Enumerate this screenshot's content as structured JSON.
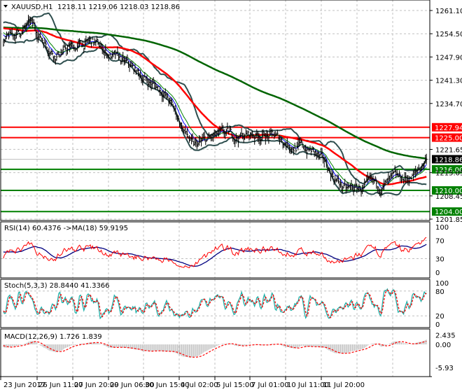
{
  "header": {
    "symbol": "XAUUSD,H1",
    "ohlc": "1218.11 1219.06 1218.03 1218.86"
  },
  "colors": {
    "background": "#ffffff",
    "grid": "#c0c0c0",
    "bars": "#000000",
    "ma_fast": "#0000ff",
    "ma_mid": "#008000",
    "ma_red": "#ff0000",
    "ma_long": "#006400",
    "bollinger": "#2f4f4f",
    "resistance": "#ff0000",
    "support": "#008000",
    "rsi": "#ff0000",
    "rsi_ma": "#000080",
    "stoch_main": "#20b2aa",
    "stoch_signal": "#ff0000",
    "macd_hist": "#c0c0c0",
    "macd_signal": "#ff0000"
  },
  "chart_data": [
    {
      "type": "candlestick-bars",
      "title": "XAUUSD,H1",
      "ylim": [
        1201.85,
        1263.5
      ],
      "y_ticks": [
        "1261.10",
        "1254.50",
        "1247.90",
        "1241.30",
        "1234.70",
        "1221.65",
        "1215.05",
        "1208.45",
        "1201.85"
      ],
      "x_ticks": [
        "23 Jun 2017",
        "26 Jun 11:00",
        "27 Jun 20:00",
        "29 Jun 06:00",
        "30 Jun 15:00",
        "4 Jul 02:00",
        "5 Jul 15:00",
        "7 Jul 01:00",
        "10 Jul 11:00",
        "11 Jul 20:00"
      ],
      "close_path_approx": [
        [
          "23 Jun 2017",
          1252
        ],
        [
          "24 Jun",
          1257
        ],
        [
          "26 Jun 11:00",
          1249
        ],
        [
          "27 Jun 20:00",
          1252
        ],
        [
          "29 Jun 06:00",
          1245
        ],
        [
          "30 Jun 15:00",
          1238
        ],
        [
          "3 Jul",
          1222
        ],
        [
          "4 Jul 02:00",
          1225
        ],
        [
          "5 Jul 15:00",
          1226
        ],
        [
          "7 Jul 01:00",
          1221
        ],
        [
          "7 Jul 15:00",
          1210
        ],
        [
          "10 Jul 11:00",
          1211
        ],
        [
          "11 Jul 20:00",
          1214
        ],
        [
          "12 Jul",
          1218.86
        ]
      ],
      "current_price": "1218.86",
      "levels": [
        {
          "value": "1227.94",
          "kind": "resistance"
        },
        {
          "value": "1225.00",
          "kind": "resistance"
        },
        {
          "value": "1216.00",
          "kind": "support"
        },
        {
          "value": "1210.00",
          "kind": "support"
        },
        {
          "value": "1204.00",
          "kind": "support"
        }
      ],
      "overlays": [
        "Bollinger Bands",
        "Moving Average (red)",
        "Moving Average (dark green)",
        "Moving Average (blue)",
        "Moving Average (green)"
      ]
    },
    {
      "type": "line",
      "label": "RSI(14) 60.4376  ->MA(18) 59.9195",
      "ylim": [
        0,
        100
      ],
      "y_ticks": [
        "100",
        "70",
        "30",
        "0"
      ],
      "last": {
        "rsi": 60.4376,
        "ma": 59.9195
      }
    },
    {
      "type": "line",
      "label": "Stoch(5,3,3) 28.8440 41.3366",
      "ylim": [
        0,
        100
      ],
      "y_ticks": [
        "100",
        "80",
        "20",
        "0"
      ],
      "last": {
        "main": 28.844,
        "signal": 41.3366
      }
    },
    {
      "type": "bar",
      "label": "MACD(12,26,9) 1.726 1.839",
      "ylim": [
        -5.93,
        2.435
      ],
      "y_ticks": [
        "2.435",
        "0.00",
        "-5.93"
      ],
      "last": {
        "macd": 1.726,
        "signal": 1.839
      }
    }
  ]
}
